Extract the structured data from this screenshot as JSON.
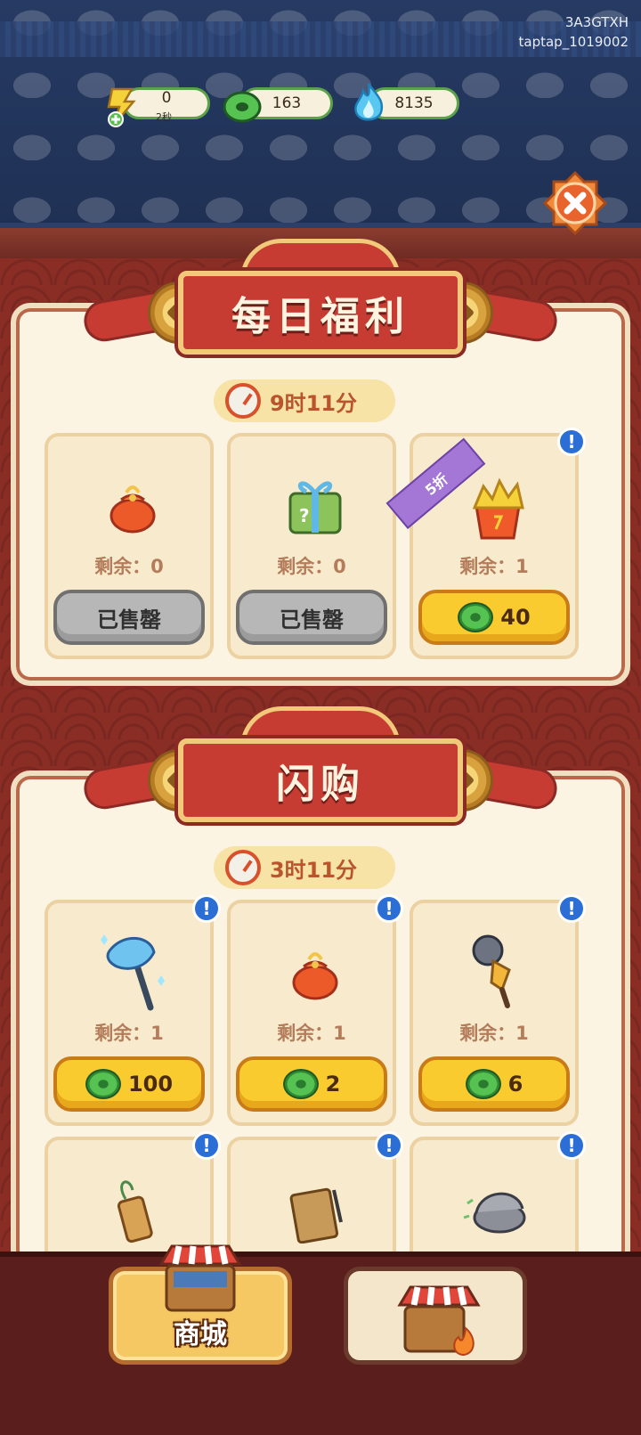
{
  "account": {
    "code_line1": "3A3GTXH",
    "code_line2": "taptap_1019002"
  },
  "resources": {
    "energy": {
      "value": "0",
      "sub": "2秒",
      "icon": "energy-lightning-icon"
    },
    "coins": {
      "value": "163",
      "icon": "jade-coin-icon"
    },
    "flame": {
      "value": "8135",
      "icon": "blue-flame-icon"
    }
  },
  "daily": {
    "title": "每日福利",
    "timer": "9时11分",
    "items": [
      {
        "icon": "lucky-bag-icon",
        "remain": "剩余：0",
        "button": "已售罄"
      },
      {
        "icon": "mystery-gift-box-icon",
        "remain": "剩余：0",
        "button": "已售罄"
      },
      {
        "icon": "gold-nuggets-bucket-icon",
        "remain": "剩余：1",
        "price": "40",
        "tag": "5折"
      }
    ]
  },
  "flash": {
    "title": "闪购",
    "timer": "3时11分",
    "items": [
      {
        "icon": "crystal-axe-icon",
        "remain": "剩余：1",
        "price": "100"
      },
      {
        "icon": "lucky-bag-icon",
        "remain": "剩余：1",
        "price": "2"
      },
      {
        "icon": "microphone-icon",
        "remain": "剩余：1",
        "price": "6"
      },
      {
        "icon": "wooden-tag-icon"
      },
      {
        "icon": "notebook-icon"
      },
      {
        "icon": "oyster-icon"
      }
    ]
  },
  "nav": {
    "shop_label": "商城"
  },
  "colors": {
    "accent_red": "#c63c33",
    "gold": "#f9cb2f",
    "jade": "#56c252",
    "alert_blue": "#2b6fd6"
  }
}
